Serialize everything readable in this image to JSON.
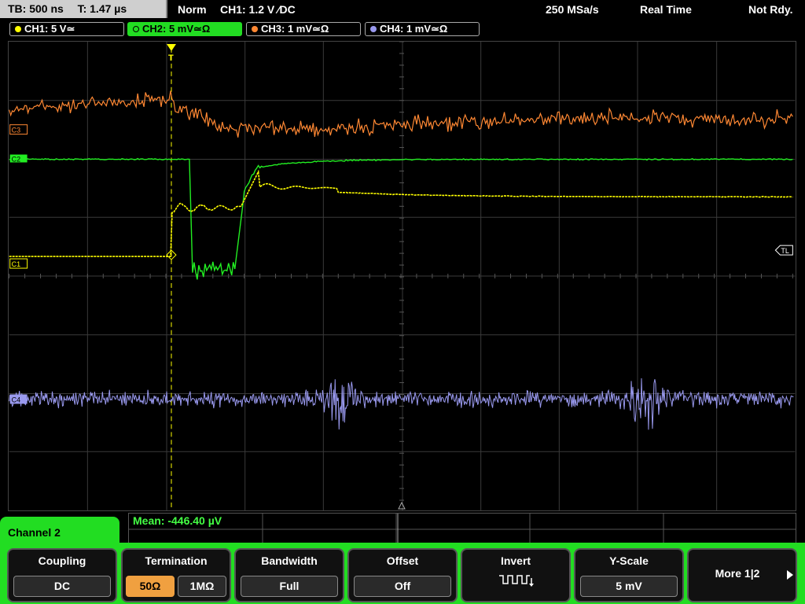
{
  "status_bar": {
    "timebase": "TB: 500 ns",
    "trigger_time": "T: 1.47 µs",
    "trigger_mode": "Norm",
    "trigger_source": "CH1: 1.2 V ∕DC",
    "sample_rate": "250 MSa/s",
    "acq_mode": "Real Time",
    "status": "Not Rdy."
  },
  "channels": [
    {
      "label": "CH1: 5 V≃",
      "color": "#ffff00"
    },
    {
      "label": "CH2: 5 mV≃Ω",
      "color": "#22dd22"
    },
    {
      "label": "CH3: 1 mV≃Ω",
      "color": "#ff8833"
    },
    {
      "label": "CH4: 1 mV≃Ω",
      "color": "#9999ee"
    }
  ],
  "markers": {
    "c3": "C3",
    "c2": "C2",
    "c1": "C1",
    "c4": "C4",
    "tl": "TL",
    "trigger": "T"
  },
  "measurement": {
    "mean": "Mean: -446.40 µV"
  },
  "panel": {
    "title": "Channel 2",
    "coupling": {
      "title": "Coupling",
      "value": "DC"
    },
    "termination": {
      "title": "Termination",
      "opt1": "50Ω",
      "opt2": "1MΩ"
    },
    "bandwidth": {
      "title": "Bandwidth",
      "value": "Full"
    },
    "offset": {
      "title": "Offset",
      "value": "Off"
    },
    "invert": {
      "title": "Invert"
    },
    "yscale": {
      "title": "Y-Scale",
      "value": "5 mV"
    },
    "more": {
      "label": "More 1|2"
    }
  }
}
